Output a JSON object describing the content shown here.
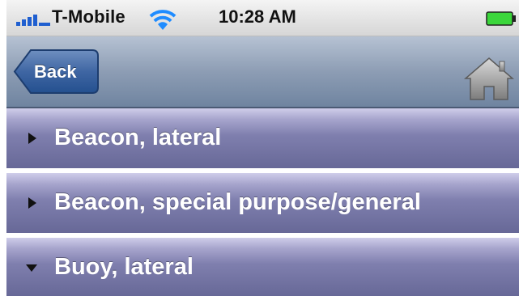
{
  "status_bar": {
    "carrier": "T-Mobile",
    "time": "10:28 AM"
  },
  "nav_bar": {
    "back_label": "Back",
    "home_icon": "home-icon"
  },
  "list": [
    {
      "label": "Beacon, lateral",
      "expanded": false
    },
    {
      "label": "Beacon, special purpose/general",
      "expanded": false
    },
    {
      "label": "Buoy, lateral",
      "expanded": true
    }
  ],
  "colors": {
    "battery": "#3bd63b",
    "wifi": "#1f8cff",
    "row_bottom": "#676897"
  }
}
